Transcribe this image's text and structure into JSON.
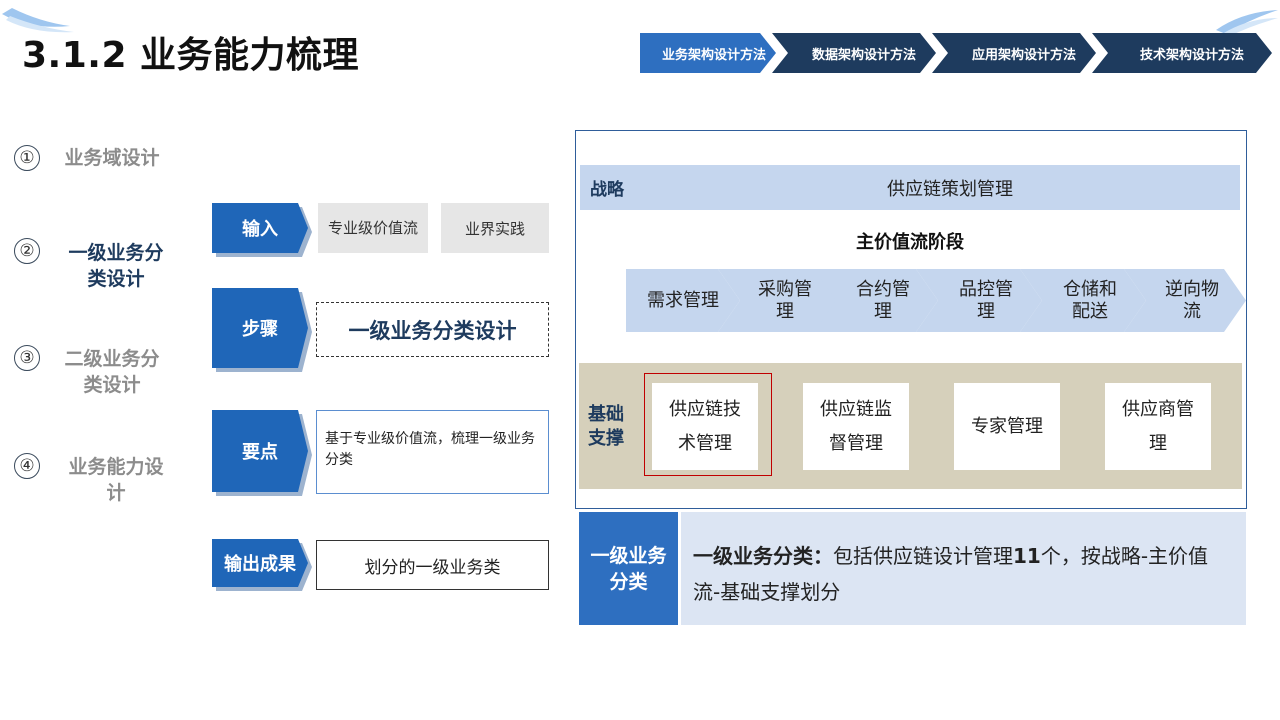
{
  "title": "3.1.2 业务能力梳理",
  "nav": {
    "steps": [
      {
        "label": "业务架构设计方法"
      },
      {
        "label": "数据架构设计方法"
      },
      {
        "label": "应用架构设计方法"
      },
      {
        "label": "技术架构设计方法"
      }
    ]
  },
  "left_steps": [
    {
      "num": "①",
      "label": "业务域设计"
    },
    {
      "num": "②",
      "label": "一级业务分类设计"
    },
    {
      "num": "③",
      "label": "二级业务分类设计"
    },
    {
      "num": "④",
      "label": "业务能力设计"
    }
  ],
  "middle": {
    "input_label": "输入",
    "input_items": [
      "专业级价值流",
      "业界实践"
    ],
    "step_label": "步骤",
    "step_text": "一级业务分类设计",
    "key_label": "要点",
    "key_text": "基于专业级价值流，梳理一级业务分类",
    "output_label": "输出成果",
    "output_text": "划分的一级业务类"
  },
  "diagram": {
    "strategy_label": "战略",
    "strategy_text": "供应链策划管理",
    "value_title": "主价值流阶段",
    "stages": [
      "需求管理",
      "采购管理",
      "合约管理",
      "品控管理",
      "仓储和配送",
      "逆向物流"
    ],
    "base_label": "基础支撑",
    "base_items": [
      "供应链技术管理",
      "供应链监督管理",
      "专家管理",
      "供应商管理"
    ]
  },
  "summary": {
    "label": "一级业务分类",
    "bold_text": "一级业务分类：",
    "text": "包括供应链设计管理",
    "count": "11",
    "text2": "个，按战略-主价值流-基础支撑划分"
  },
  "colors": {
    "primary": "#1f66b8",
    "nav_active": "#2e6fc0",
    "nav_inactive": "#1e3b5e",
    "light_blue": "#c5d6ee",
    "beige": "#d6d0bb",
    "highlight_red": "#c00000"
  }
}
